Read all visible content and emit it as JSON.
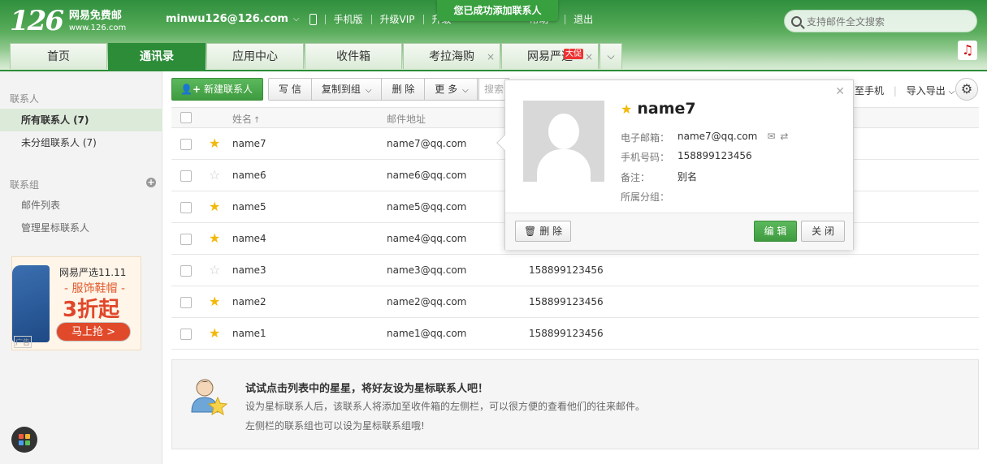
{
  "logo": {
    "num": "126",
    "name": "网易免费邮",
    "domain": "www.126.com"
  },
  "topnav": {
    "account": "minwu126@126.com",
    "items": [
      "手机版",
      "升级VIP",
      "升级",
      "帮助",
      "退出"
    ]
  },
  "toast": "您已成功添加联系人",
  "search": {
    "placeholder": "支持邮件全文搜索"
  },
  "tabs": [
    {
      "label": "首页"
    },
    {
      "label": "通讯录",
      "active": true
    },
    {
      "label": "应用中心"
    },
    {
      "label": "收件箱"
    },
    {
      "label": "考拉海购",
      "close": "×"
    },
    {
      "label": "网易严选",
      "badge": "大促",
      "close": "×"
    }
  ],
  "sidebar": {
    "contacts_header": "联系人",
    "all_contacts": "所有联系人 (7)",
    "ungrouped": "未分组联系人 (7)",
    "groups_header": "联系组",
    "mail_list": "邮件列表",
    "manage_starred": "管理星标联系人"
  },
  "ad": {
    "line1": "网易严选11.11",
    "line2": "- 服饰鞋帽 -",
    "line3": "3折起",
    "button": "马上抢 >",
    "tag": "广告"
  },
  "toolbar": {
    "new_contact": "新建联系人",
    "write": "写 信",
    "copy_to_group": "复制到组",
    "delete": "删 除",
    "more": "更 多",
    "search_placeholder": "搜索",
    "to_phone": "至手机",
    "import_export": "导入导出"
  },
  "table": {
    "col_name": "姓名",
    "col_email": "邮件地址",
    "rows": [
      {
        "name": "name7",
        "email": "name7@qq.com",
        "phone": "",
        "starred": true
      },
      {
        "name": "name6",
        "email": "name6@qq.com",
        "phone": "",
        "starred": false
      },
      {
        "name": "name5",
        "email": "name5@qq.com",
        "phone": "",
        "starred": true
      },
      {
        "name": "name4",
        "email": "name4@qq.com",
        "phone": "",
        "starred": true
      },
      {
        "name": "name3",
        "email": "name3@qq.com",
        "phone": "158899123456",
        "starred": false
      },
      {
        "name": "name2",
        "email": "name2@qq.com",
        "phone": "158899123456",
        "starred": true
      },
      {
        "name": "name1",
        "email": "name1@qq.com",
        "phone": "158899123456",
        "starred": true
      }
    ]
  },
  "tip": {
    "title": "试试点击列表中的星星，将好友设为星标联系人吧！",
    "line1": "设为星标联系人后，该联系人将添加至收件箱的左侧栏，可以很方便的查看他们的往来邮件。",
    "line2": "左侧栏的联系组也可以设为星标联系组哦!"
  },
  "popup": {
    "name": "name7",
    "email_label": "电子邮箱：",
    "email": "name7@qq.com",
    "phone_label": "手机号码：",
    "phone": "158899123456",
    "note_label": "备注：",
    "note": "别名",
    "group_label": "所属分组：",
    "delete": "删 除",
    "edit": "编 辑",
    "close": "关 闭"
  },
  "colors": {
    "brand_green": "#2c8c38",
    "star": "#f2b90c",
    "button_green": "#4aa94a"
  }
}
